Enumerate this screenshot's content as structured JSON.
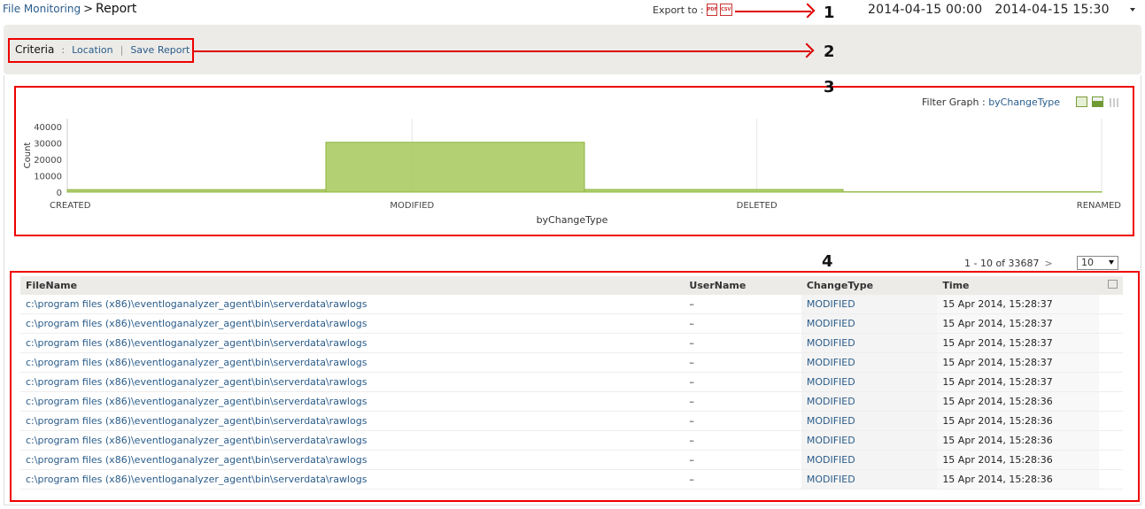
{
  "breadcrumb": {
    "parent": "File Monitoring",
    "separator": ">",
    "current": "Report"
  },
  "export": {
    "label": "Export to :",
    "icons": [
      "pdf-icon",
      "csv-icon"
    ],
    "pdf_text": "PDF",
    "csv_text": "CSV"
  },
  "date_range": {
    "start": "2014-04-15 00:00",
    "end": "2014-04-15 15:30"
  },
  "annotations": [
    "1",
    "2",
    "3",
    "4"
  ],
  "criteria": {
    "label": "Criteria",
    "colon": ":",
    "links": [
      "Location",
      "Save Report"
    ],
    "separator": "|"
  },
  "filter_graph": {
    "label": "Filter Graph :",
    "value": "byChangeType",
    "icons": [
      "line-chart-icon",
      "area-chart-icon",
      "bar-chart-icon"
    ]
  },
  "chart_data": {
    "type": "area",
    "x": [
      "CREATED",
      "MODIFIED",
      "DELETED",
      "RENAMED"
    ],
    "series": [
      {
        "values": [
          1500,
          30500,
          1600,
          200
        ]
      }
    ],
    "xlabel": "byChangeType",
    "ylabel": "Count",
    "ylim": [
      0,
      45000
    ],
    "yticks": [
      0,
      10000,
      20000,
      30000,
      40000
    ],
    "color": "#a6c95a",
    "grid": true
  },
  "pagination": {
    "range_text": "1 - 10 of 33687",
    "next_symbol": ">",
    "page_size": "10"
  },
  "table": {
    "columns": [
      "FileName",
      "UserName",
      "ChangeType",
      "Time"
    ],
    "rows": [
      [
        "c:\\program files (x86)\\eventloganalyzer_agent\\bin\\serverdata\\rawlogs",
        "–",
        "MODIFIED",
        "15 Apr 2014, 15:28:37"
      ],
      [
        "c:\\program files (x86)\\eventloganalyzer_agent\\bin\\serverdata\\rawlogs",
        "–",
        "MODIFIED",
        "15 Apr 2014, 15:28:37"
      ],
      [
        "c:\\program files (x86)\\eventloganalyzer_agent\\bin\\serverdata\\rawlogs",
        "–",
        "MODIFIED",
        "15 Apr 2014, 15:28:37"
      ],
      [
        "c:\\program files (x86)\\eventloganalyzer_agent\\bin\\serverdata\\rawlogs",
        "–",
        "MODIFIED",
        "15 Apr 2014, 15:28:37"
      ],
      [
        "c:\\program files (x86)\\eventloganalyzer_agent\\bin\\serverdata\\rawlogs",
        "–",
        "MODIFIED",
        "15 Apr 2014, 15:28:37"
      ],
      [
        "c:\\program files (x86)\\eventloganalyzer_agent\\bin\\serverdata\\rawlogs",
        "–",
        "MODIFIED",
        "15 Apr 2014, 15:28:36"
      ],
      [
        "c:\\program files (x86)\\eventloganalyzer_agent\\bin\\serverdata\\rawlogs",
        "–",
        "MODIFIED",
        "15 Apr 2014, 15:28:36"
      ],
      [
        "c:\\program files (x86)\\eventloganalyzer_agent\\bin\\serverdata\\rawlogs",
        "–",
        "MODIFIED",
        "15 Apr 2014, 15:28:36"
      ],
      [
        "c:\\program files (x86)\\eventloganalyzer_agent\\bin\\serverdata\\rawlogs",
        "–",
        "MODIFIED",
        "15 Apr 2014, 15:28:36"
      ],
      [
        "c:\\program files (x86)\\eventloganalyzer_agent\\bin\\serverdata\\rawlogs",
        "–",
        "MODIFIED",
        "15 Apr 2014, 15:28:36"
      ]
    ]
  }
}
